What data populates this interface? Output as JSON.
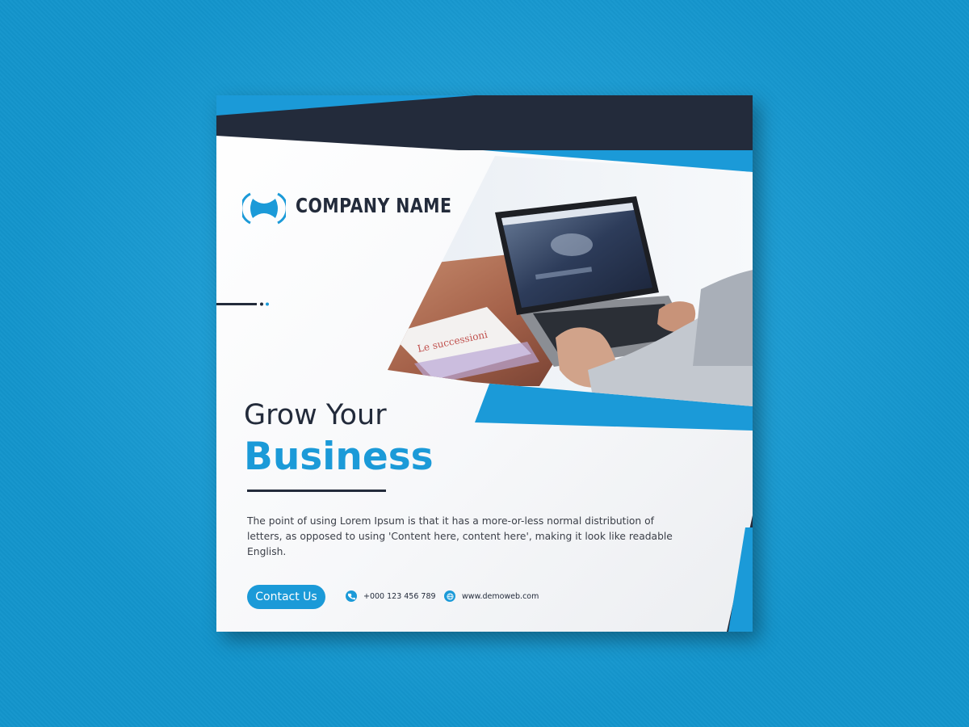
{
  "card": {
    "company_name": "COMPANY NAME",
    "headline_line1": "Grow Your",
    "headline_line2": "Business",
    "body_text": "The point of using Lorem Ipsum is that it has a more-or-less normal distribution of letters, as opposed to using 'Content here, content here', making it look like readable English.",
    "cta_label": "Contact Us",
    "phone": "+000 123 456 789",
    "website": "www.demoweb.com",
    "photo": {
      "subject": "hands typing on a laptop showing a handshake website",
      "document_text": "Le successioni"
    },
    "icons": {
      "logo": "company-logo-icon",
      "phone": "phone-icon",
      "web": "globe-icon"
    }
  },
  "colors": {
    "background": "#149ed9",
    "accent": "#1b9ad8",
    "dark": "#232b3b",
    "card": "#ffffff"
  }
}
